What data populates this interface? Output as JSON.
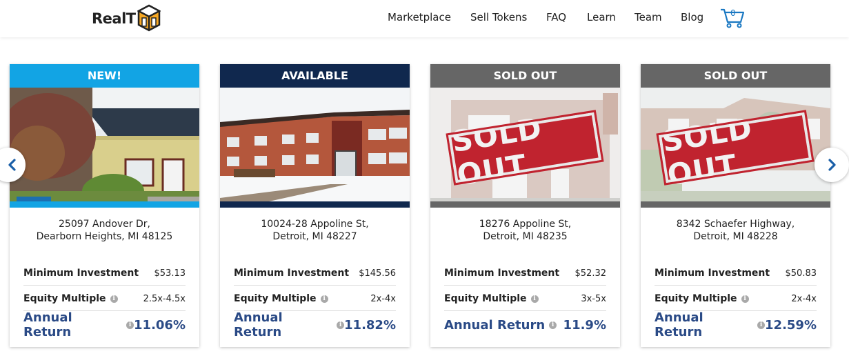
{
  "header": {
    "logo_text": "RealT",
    "nav": [
      "Marketplace",
      "Sell Tokens",
      "FAQ",
      "Learn",
      "Team",
      "Blog"
    ],
    "cart_count": "0"
  },
  "labels": {
    "min_investment": "Minimum Investment",
    "equity_multiple": "Equity Multiple",
    "annual_return": "Annual Return"
  },
  "stamp_text": "SOLD OUT",
  "cards": [
    {
      "status": "NEW!",
      "status_color": "#12a4e4",
      "address_line1": "25097 Andover Dr,",
      "address_line2": "Dearborn Heights, MI 48125",
      "min_investment": "$53.13",
      "equity_multiple": "2.5x-4.5x",
      "annual_return": "11.06%"
    },
    {
      "status": "AVAILABLE",
      "status_color": "#10284e",
      "address_line1": "10024-28 Appoline St,",
      "address_line2": "Detroit, MI 48227",
      "min_investment": "$145.56",
      "equity_multiple": "2x-4x",
      "annual_return": "11.82%"
    },
    {
      "status": "SOLD OUT",
      "status_color": "#666666",
      "address_line1": "18276 Appoline St,",
      "address_line2": "Detroit, MI 48235",
      "min_investment": "$52.32",
      "equity_multiple": "3x-5x",
      "annual_return": "11.9%"
    },
    {
      "status": "SOLD OUT",
      "status_color": "#666666",
      "address_line1": "8342 Schaefer Highway,",
      "address_line2": "Detroit, MI 48228",
      "min_investment": "$50.83",
      "equity_multiple": "2x-4x",
      "annual_return": "12.59%"
    }
  ],
  "colors": {
    "accent_blue": "#1a78c2",
    "return_blue": "#2a4a86",
    "stamp_red": "#c0232f"
  }
}
